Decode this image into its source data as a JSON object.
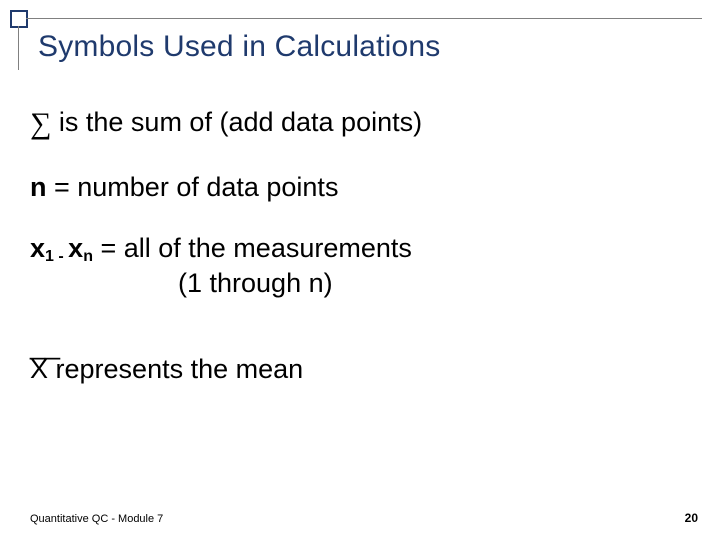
{
  "title": "Symbols Used in Calculations",
  "rows": {
    "sigma": {
      "symbol": "∑",
      "text": "  is the sum of (add data points)"
    },
    "n": {
      "symbol": "n",
      "text": "  = number of data points"
    },
    "x_range": {
      "x": "x",
      "sub1": "1 ",
      "dash": "- ",
      "subn": "n",
      "text": " = all of the measurements",
      "line2": "(1 through n)"
    },
    "xbar": {
      "overline": "__",
      "symbol": " X",
      "text": "  represents the mean"
    }
  },
  "footer": {
    "left": "Quantitative QC - Module 7",
    "right": "20"
  }
}
